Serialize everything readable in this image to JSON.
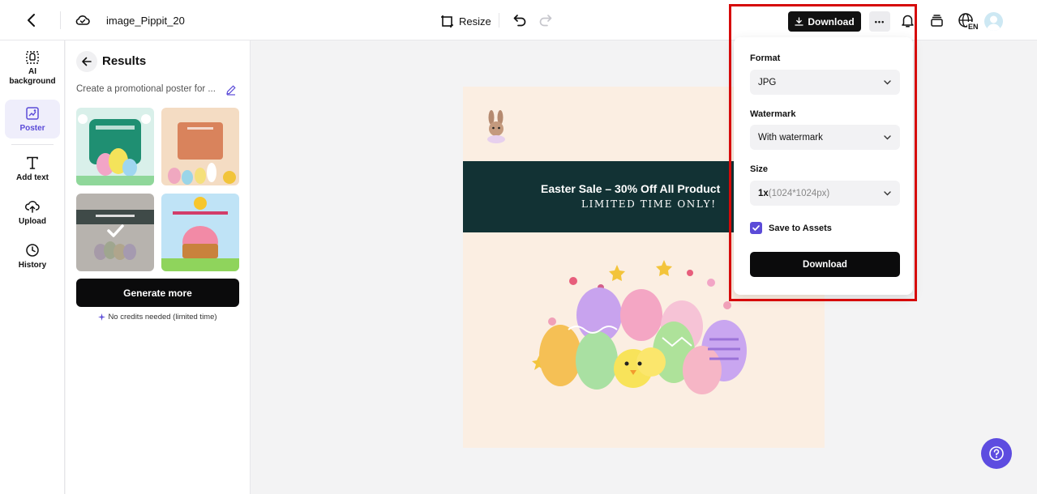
{
  "header": {
    "file_name": "image_Pippit_20",
    "resize_label": "Resize",
    "download_label": "Download",
    "more_label": "•••",
    "language_code": "EN"
  },
  "rail": {
    "items": [
      {
        "label": "AI background",
        "icon": "ai-background-icon"
      },
      {
        "label": "Poster",
        "icon": "poster-icon",
        "active": true
      },
      {
        "label": "Add text",
        "icon": "text-icon"
      },
      {
        "label": "Upload",
        "icon": "upload-icon"
      },
      {
        "label": "History",
        "icon": "history-icon"
      }
    ]
  },
  "results": {
    "title": "Results",
    "prompt": "Create a promotional poster for ...",
    "generate_label": "Generate more",
    "credits_note": "No credits needed (limited time)"
  },
  "poster": {
    "headline": "Easter Sale – 30% Off All Product",
    "subline": "LIMITED TIME ONLY!"
  },
  "download_panel": {
    "format_label": "Format",
    "format_value": "JPG",
    "watermark_label": "Watermark",
    "watermark_value": "With watermark",
    "size_label": "Size",
    "size_value": "1x",
    "size_detail": "(1024*1024px)",
    "save_label": "Save to Assets",
    "save_checked": true,
    "download_label": "Download"
  },
  "colors": {
    "accent": "#5b4bd8",
    "highlight": "#d60a0a",
    "banner": "#123234"
  }
}
